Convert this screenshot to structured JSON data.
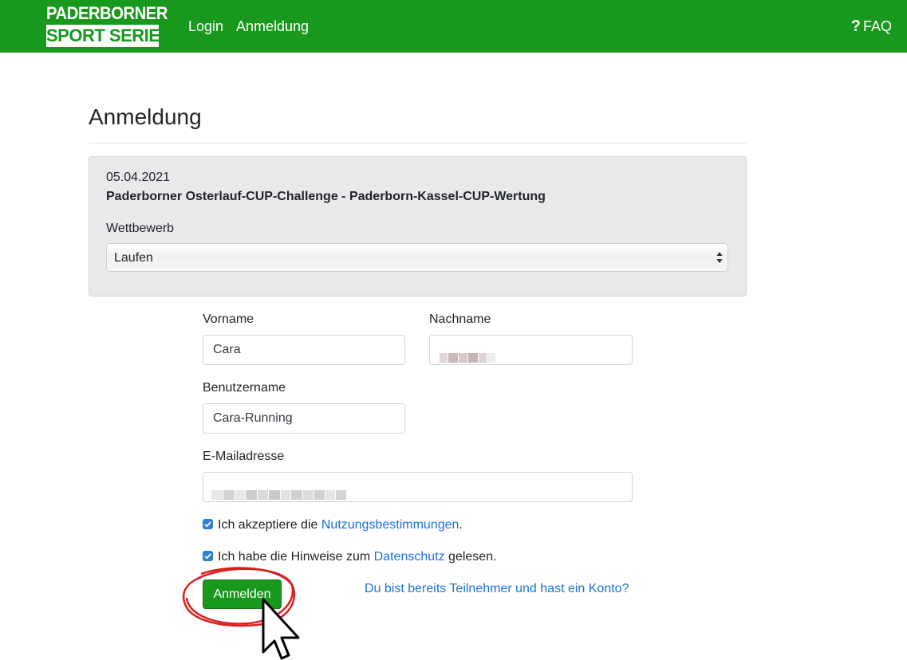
{
  "navbar": {
    "logo_top": "PADERBORNER",
    "logo_bottom": "SPORT SERIE",
    "links": [
      {
        "label": "Login"
      },
      {
        "label": "Anmeldung"
      }
    ],
    "faq_label": "FAQ",
    "colors": {
      "brand": "#18981d"
    }
  },
  "page": {
    "title": "Anmeldung"
  },
  "event": {
    "date": "05.04.2021",
    "name": "Paderborner Osterlauf-CUP-Challenge - Paderborn-Kassel-CUP-Wertung",
    "competition_label": "Wettbewerb",
    "competition_selected": "Laufen"
  },
  "form": {
    "firstname_label": "Vorname",
    "firstname_value": "Cara",
    "lastname_label": "Nachname",
    "username_label": "Benutzername",
    "username_value": "Cara-Running",
    "email_label": "E-Mailadresse",
    "terms_text": "Ich akzeptiere die ",
    "terms_link": "Nutzungsbestimmungen",
    "terms_end": ".",
    "terms_checked": true,
    "privacy_text": "Ich habe die Hinweise zum ",
    "privacy_link": "Datenschutz",
    "privacy_end": " gelesen.",
    "privacy_checked": true,
    "submit_label": "Anmelden",
    "account_link": "Du bist bereits Teilnehmer und hast ein Konto?"
  },
  "icons": {
    "faq": "question-icon",
    "select": "sort-arrows-icon",
    "checkbox": "check-icon",
    "pointer": "cursor-arrow-icon"
  },
  "colors": {
    "link": "#1a73d9",
    "checkbox": "#2f80d1",
    "annotation": "#d9201f"
  }
}
